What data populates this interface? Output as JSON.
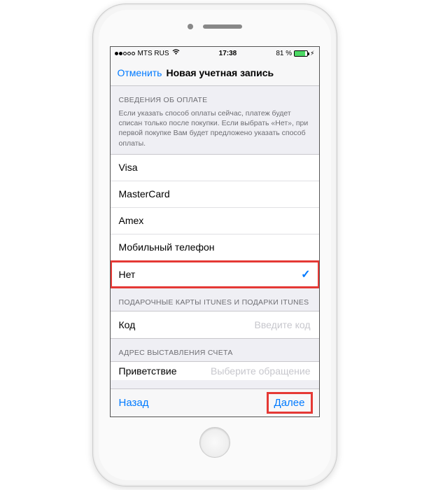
{
  "status": {
    "carrier": "MTS RUS",
    "time": "17:38",
    "battery_pct": "81 %"
  },
  "nav": {
    "cancel": "Отменить",
    "title": "Новая учетная запись"
  },
  "payment": {
    "header": "СВЕДЕНИЯ ОБ ОПЛАТЕ",
    "note": "Если указать способ оплаты сейчас, платеж будет списан только после покупки. Если выбрать «Нет», при первой покупке Вам будет предложено указать способ оплаты.",
    "options": [
      "Visa",
      "MasterCard",
      "Amex",
      "Мобильный телефон",
      "Нет"
    ],
    "selected_index": 4
  },
  "gift": {
    "header": "ПОДАРОЧНЫЕ КАРТЫ ITUNES И ПОДАРКИ ITUNES",
    "code_label": "Код",
    "code_placeholder": "Введите код"
  },
  "billing": {
    "header": "АДРЕС ВЫСТАВЛЕНИЯ СЧЕТА",
    "salutation_label": "Приветствие",
    "salutation_placeholder": "Выберите обращение"
  },
  "footer": {
    "back": "Назад",
    "next": "Далее"
  }
}
